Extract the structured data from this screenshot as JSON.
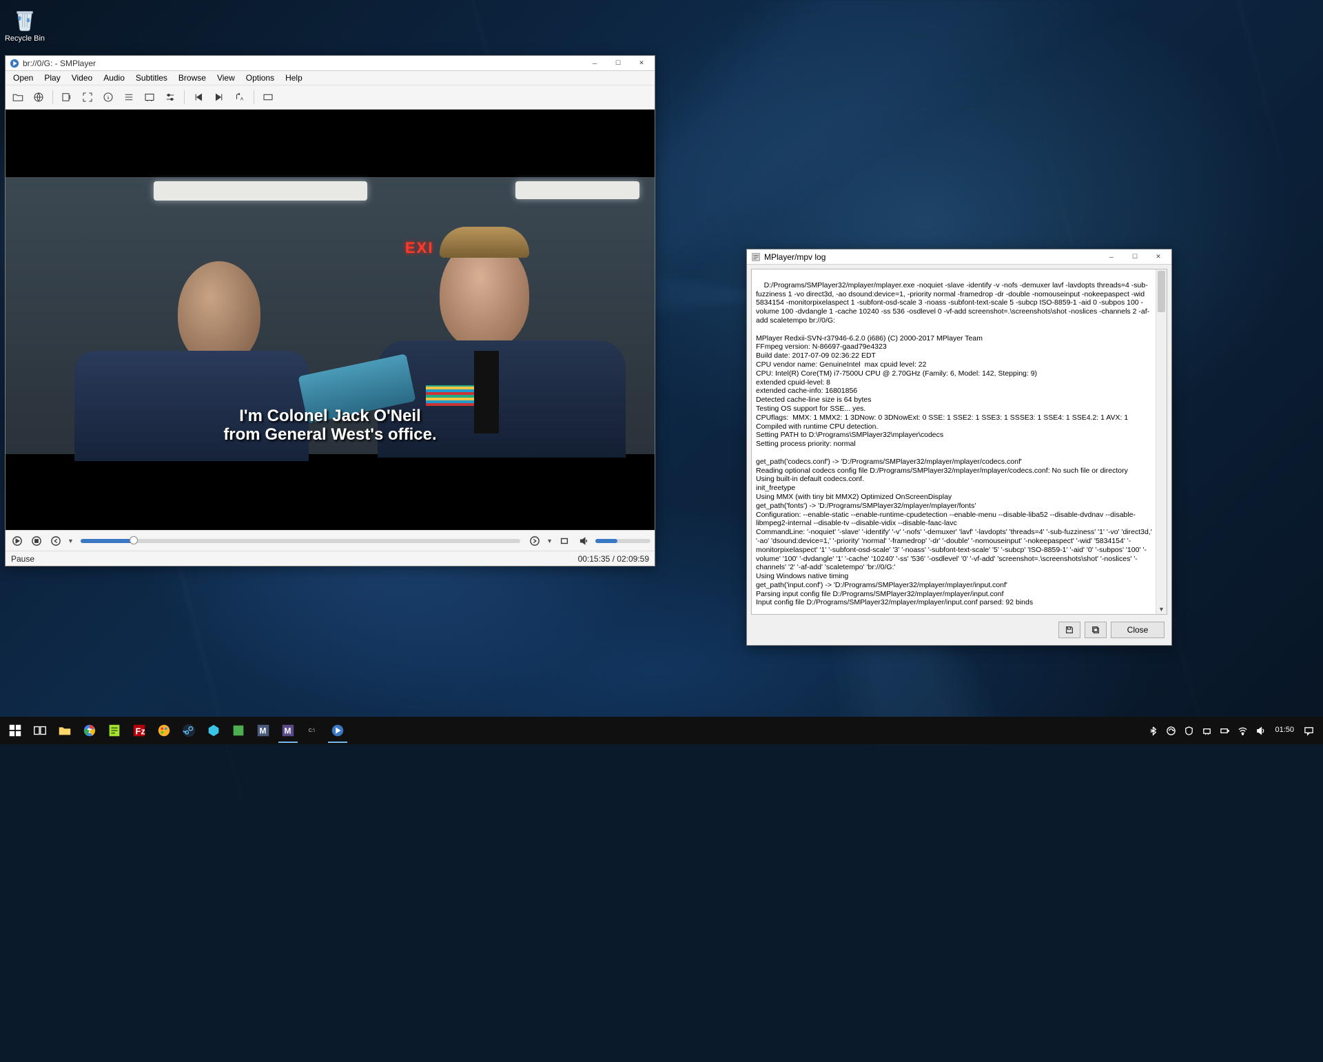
{
  "desktop": {
    "recycle_bin": "Recycle Bin"
  },
  "smplayer": {
    "title": "br://0/G: - SMPlayer",
    "menu": [
      "Open",
      "Play",
      "Video",
      "Audio",
      "Subtitles",
      "Browse",
      "View",
      "Options",
      "Help"
    ],
    "subtitle_line1": "I'm Colonel Jack O'Neil",
    "subtitle_line2": "from General West's office.",
    "exit_sign": "EXI",
    "status_left": "Pause",
    "status_right": "00:15:35 / 02:09:59",
    "seek_pct": 12,
    "volume_pct": 40
  },
  "logwin": {
    "title": "MPlayer/mpv log",
    "close": "Close",
    "text": "D:/Programs/SMPlayer32/mplayer/mplayer.exe -noquiet -slave -identify -v -nofs -demuxer lavf -lavdopts threads=4 -sub-fuzziness 1 -vo direct3d, -ao dsound:device=1, -priority normal -framedrop -dr -double -nomouseinput -nokeepaspect -wid 5834154 -monitorpixelaspect 1 -subfont-osd-scale 3 -noass -subfont-text-scale 5 -subcp ISO-8859-1 -aid 0 -subpos 100 -volume 100 -dvdangle 1 -cache 10240 -ss 536 -osdlevel 0 -vf-add screenshot=.\\screenshots\\shot -noslices -channels 2 -af-add scaletempo br://0/G:\n\nMPlayer Redxii-SVN-r37946-6.2.0 (i686) (C) 2000-2017 MPlayer Team\nFFmpeg version: N-86697-gaad79e4323\nBuild date: 2017-07-09 02:36:22 EDT\nCPU vendor name: GenuineIntel  max cpuid level: 22\nCPU: Intel(R) Core(TM) i7-7500U CPU @ 2.70GHz (Family: 6, Model: 142, Stepping: 9)\nextended cpuid-level: 8\nextended cache-info: 16801856\nDetected cache-line size is 64 bytes\nTesting OS support for SSE... yes.\nCPUflags:  MMX: 1 MMX2: 1 3DNow: 0 3DNowExt: 0 SSE: 1 SSE2: 1 SSE3: 1 SSSE3: 1 SSE4: 1 SSE4.2: 1 AVX: 1\nCompiled with runtime CPU detection.\nSetting PATH to D:\\Programs\\SMPlayer32\\mplayer\\codecs\nSetting process priority: normal\n\nget_path('codecs.conf') -> 'D:/Programs/SMPlayer32/mplayer/mplayer/codecs.conf'\nReading optional codecs config file D:/Programs/SMPlayer32/mplayer/mplayer/codecs.conf: No such file or directory\nUsing built-in default codecs.conf.\ninit_freetype\nUsing MMX (with tiny bit MMX2) Optimized OnScreenDisplay\nget_path('fonts') -> 'D:/Programs/SMPlayer32/mplayer/mplayer/fonts'\nConfiguration: --enable-static --enable-runtime-cpudetection --enable-menu --disable-liba52 --disable-dvdnav --disable-libmpeg2-internal --disable-tv --disable-vidix --disable-faac-lavc\nCommandLine: '-noquiet' '-slave' '-identify' '-v' '-nofs' '-demuxer' 'lavf' '-lavdopts' 'threads=4' '-sub-fuzziness' '1' '-vo' 'direct3d,' '-ao' 'dsound:device=1,' '-priority' 'normal' '-framedrop' '-dr' '-double' '-nomouseinput' '-nokeepaspect' '-wid' '5834154' '-monitorpixelaspect' '1' '-subfont-osd-scale' '3' '-noass' '-subfont-text-scale' '5' '-subcp' 'ISO-8859-1' '-aid' '0' '-subpos' '100' '-volume' '100' '-dvdangle' '1' '-cache' '10240' '-ss' '536' '-osdlevel' '0' '-vf-add' 'screenshot=.\\screenshots\\shot' '-noslices' '-channels' '2' '-af-add' 'scaletempo' 'br://0/G:'\nUsing Windows native timing\nget_path('input.conf') -> 'D:/Programs/SMPlayer32/mplayer/mplayer/input.conf'\nParsing input config file D:/Programs/SMPlayer32/mplayer/mplayer/input.conf\nInput config file D:/Programs/SMPlayer32/mplayer/mplayer/input.conf parsed: 92 binds"
  },
  "taskbar": {
    "clock": "01:50",
    "items": [
      "start",
      "taskview",
      "explorer",
      "chrome",
      "npp",
      "filezilla",
      "paint",
      "steam",
      "utorrent",
      "app1",
      "mplayer",
      "mpv",
      "cmd",
      "smplayer-task"
    ]
  },
  "tray_icons": [
    "bt",
    "sync",
    "av",
    "avg",
    "battery",
    "wifi",
    "volume"
  ]
}
